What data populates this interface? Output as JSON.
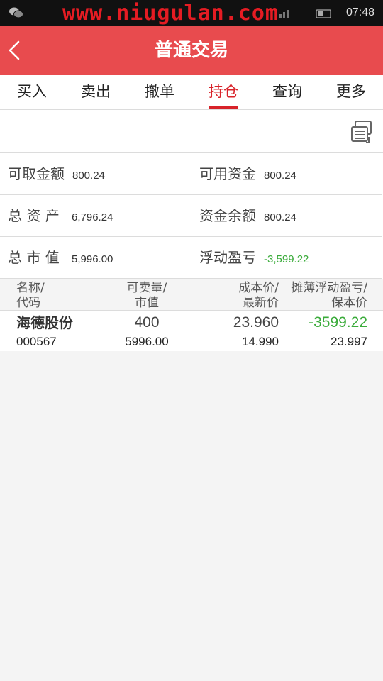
{
  "status_bar": {
    "watermark": "www.niugulan.com",
    "time": "07:48",
    "icons": [
      "wechat-icon",
      "signal-icon",
      "battery-icon"
    ]
  },
  "header": {
    "title": "普通交易",
    "back_icon": "chevron-left-icon",
    "color": "#e84b4e"
  },
  "tabs": [
    {
      "label": "买入"
    },
    {
      "label": "卖出"
    },
    {
      "label": "撤单"
    },
    {
      "label": "持仓",
      "active": true
    },
    {
      "label": "查询"
    },
    {
      "label": "更多"
    }
  ],
  "toolbar": {
    "icon": "refresh-icon"
  },
  "summary": {
    "withdrawable": {
      "label": "可取金额",
      "value": "800.24"
    },
    "available": {
      "label": "可用资金",
      "value": "800.24"
    },
    "total_assets": {
      "label": "总 资 产",
      "value": "6,796.24"
    },
    "balance": {
      "label": "资金余额",
      "value": "800.24"
    },
    "market_value": {
      "label": "总 市 值",
      "value": "5,996.00"
    },
    "floating_pl": {
      "label": "浮动盈亏",
      "value": "-3,599.22"
    }
  },
  "table": {
    "headers": {
      "col1_top": "名称/",
      "col1_bot": "代码",
      "col2_top": "可卖量/",
      "col2_bot": "市值",
      "col3_top": "成本价/",
      "col3_bot": "最新价",
      "col4_top": "摊薄浮动盈亏/",
      "col4_bot": "保本价"
    },
    "rows": [
      {
        "name": "海德股份",
        "code": "000567",
        "sellable": "400",
        "market_value": "5996.00",
        "cost_price": "23.960",
        "latest_price": "14.990",
        "floating_pl": "-3599.22",
        "breakeven": "23.997"
      }
    ]
  },
  "colors": {
    "accent": "#d8232a",
    "loss": "#3aab3a"
  }
}
